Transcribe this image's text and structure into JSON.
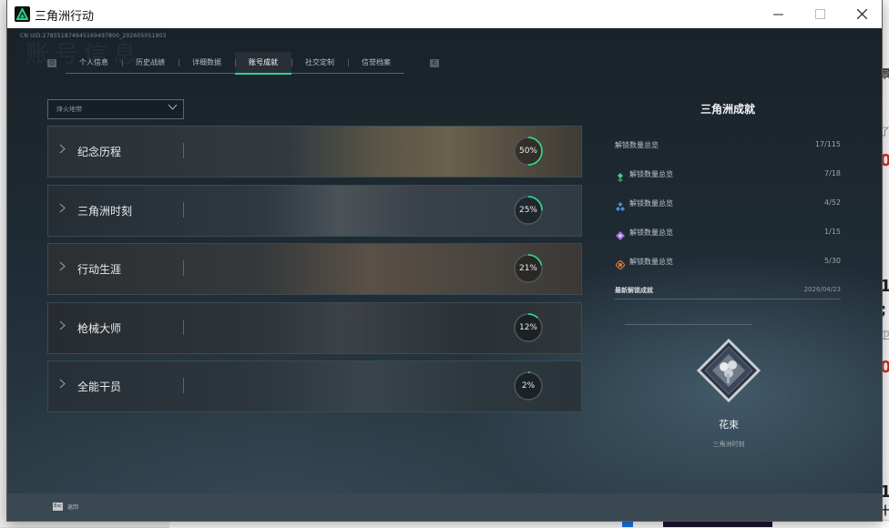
{
  "window": {
    "title": "三角洲行动"
  },
  "uid_text": "CN UID:278551874945169497800_202605051903",
  "watermark": "账号信息",
  "tabs": [
    {
      "label": "个人信息",
      "active": false
    },
    {
      "label": "历史战绩",
      "active": false
    },
    {
      "label": "详细数据",
      "active": false
    },
    {
      "label": "账号成就",
      "active": true
    },
    {
      "label": "社交定制",
      "active": false
    },
    {
      "label": "信誉档案",
      "active": false
    }
  ],
  "filter": {
    "value": "烽火地带"
  },
  "categories": [
    {
      "label": "纪念历程",
      "percent": 50,
      "percent_text": "50%"
    },
    {
      "label": "三角洲时刻",
      "percent": 25,
      "percent_text": "25%"
    },
    {
      "label": "行动生涯",
      "percent": 21,
      "percent_text": "21%"
    },
    {
      "label": "枪械大师",
      "percent": 12,
      "percent_text": "12%"
    },
    {
      "label": "全能干员",
      "percent": 2,
      "percent_text": "2%"
    }
  ],
  "summary": {
    "title": "三角洲成就",
    "total": {
      "label": "解锁数量总览",
      "value": "17/115"
    },
    "tiers": [
      {
        "label": "解锁数量总览",
        "value": "7/18",
        "color": "#3fd18c",
        "icon": "tier-green-icon"
      },
      {
        "label": "解锁数量总览",
        "value": "4/52",
        "color": "#4a8fe0",
        "icon": "tier-blue-icon"
      },
      {
        "label": "解锁数量总览",
        "value": "1/15",
        "color": "#a070e0",
        "icon": "tier-purple-icon"
      },
      {
        "label": "解锁数量总览",
        "value": "5/30",
        "color": "#e07a3a",
        "icon": "tier-orange-icon"
      }
    ],
    "recent": {
      "label": "最新解锁成就",
      "date": "2026/04/23"
    },
    "badge": {
      "name": "花束",
      "category": "三角洲时刻"
    }
  },
  "footer": {
    "esc_key": "Esc",
    "back_label": "返回"
  },
  "accent_color": "#2fd38a",
  "background": {
    "fragments": [
      "景",
      "了",
      "0",
      "1",
      ";",
      "卫",
      "0",
      "1",
      "十"
    ]
  }
}
